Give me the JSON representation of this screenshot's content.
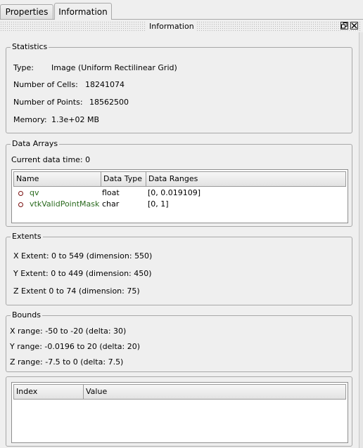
{
  "tabs": [
    {
      "label": "Properties"
    },
    {
      "label": "Information"
    }
  ],
  "dock": {
    "title": "Information",
    "float_icon": "float-icon",
    "close_icon": "close-icon"
  },
  "statistics": {
    "title": "Statistics",
    "type_label": "Type:",
    "type_value": "Image (Uniform Rectilinear Grid)",
    "cells_label": "Number of Cells:",
    "cells_value": "18241074",
    "points_label": "Number of Points:",
    "points_value": "18562500",
    "memory_label": "Memory:",
    "memory_value": "1.3e+02 MB"
  },
  "data_arrays": {
    "title": "Data Arrays",
    "current_time": "Current data time: 0",
    "columns": [
      "Name",
      "Data Type",
      "Data Ranges"
    ],
    "rows": [
      {
        "name": "qv",
        "type": "float",
        "range": "[0, 0.019109]",
        "icon": "point-data-icon"
      },
      {
        "name": "vtkValidPointMask",
        "type": "char",
        "range": "[0, 1]",
        "icon": "point-data-icon"
      }
    ]
  },
  "extents": {
    "title": "Extents",
    "x": "X Extent:  0 to 549 (dimension: 550)",
    "y": "Y Extent:  0 to 449 (dimension: 450)",
    "z": "Z Extent   0 to 74 (dimension: 75)"
  },
  "bounds": {
    "title": "Bounds",
    "x": "X range:  -50 to -20 (delta: 30)",
    "y": "Y range:  -0.0196 to 20 (delta: 20)",
    "z": "Z range:  -7.5 to 0 (delta: 7.5)"
  },
  "time_table": {
    "columns": [
      "Index",
      "Value"
    ]
  }
}
